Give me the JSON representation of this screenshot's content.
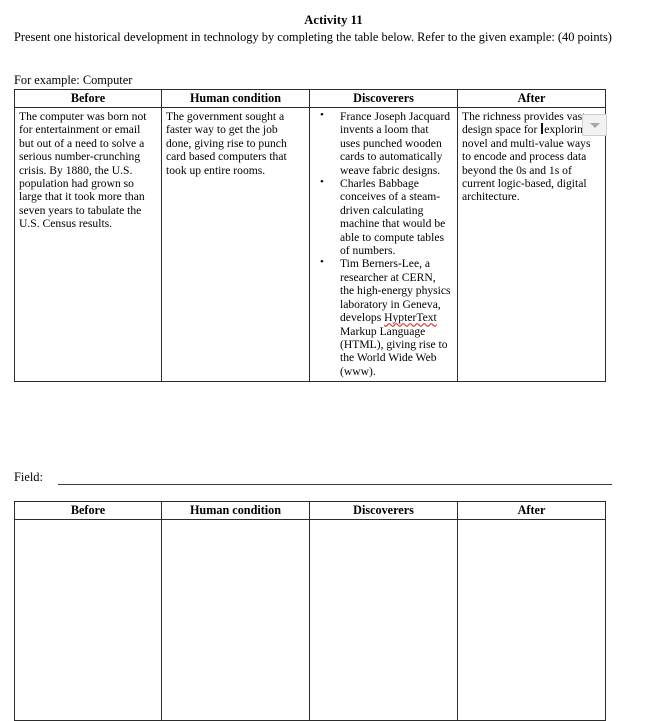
{
  "document": {
    "title": "Activity 11",
    "instructions": "Present one historical development in technology by completing the table below. Refer to the given example: (40 points)",
    "example_label": "For example: Computer",
    "field_label": "Field:",
    "field_value": ""
  },
  "table_headers": {
    "before": "Before",
    "human_condition": "Human condition",
    "discoverers": "Discoverers",
    "after": "After"
  },
  "example_table": {
    "before": "The computer was born not for entertainment or email but out of a need to solve a serious number-crunching crisis. By 1880, the U.S. population had grown so large that it took more than seven years to tabulate the U.S. Census results.",
    "human_condition": "The government sought a faster way to get the job done, giving rise to punch card based computers that took up entire rooms.",
    "discoverers": [
      "France Joseph Jacquard invents a loom that uses punched wooden cards to automatically weave fabric designs.",
      "Charles Babbage conceives of a steam-driven calculating machine that would be able to compute tables of numbers.",
      ""
    ],
    "discoverer_3_part1": "Tim Berners-Lee, a researcher at CERN, the high-energy physics laboratory in Geneva, develops ",
    "discoverer_3_misspelled": "HypterText",
    "discoverer_3_part2": " Markup Language (HTML), giving rise to the World Wide Web (www).",
    "after": "The richness provides vast design space for ",
    "after_cont": "exploring novel and multi-value ways to encode and process data beyond the 0s and 1s of current logic-based, digital architecture."
  },
  "blank_table": {
    "before": "",
    "human_condition": "",
    "discoverers": "",
    "after": ""
  },
  "widgets": {
    "dropdown_icon": "chevron-down-icon",
    "caret": "text-cursor"
  },
  "colors": {
    "text": "#000000",
    "border": "#2c2c2c",
    "spellcheck": "#d83b3b",
    "widget_bg": "#f2f2f2",
    "widget_border": "#cfcfcf",
    "chevron": "#a7a7a7"
  }
}
